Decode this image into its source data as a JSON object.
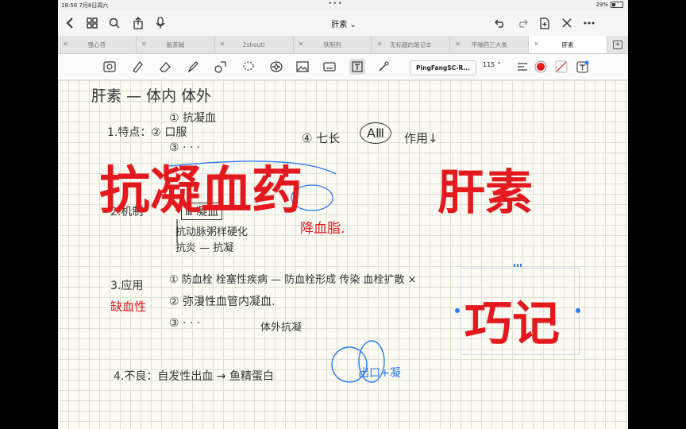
{
  "status": {
    "time": "18:58",
    "date": "7月8日周六",
    "battery": "29%"
  },
  "header": {
    "title": "肝素"
  },
  "tabs": [
    {
      "label": "强心苷",
      "active": false
    },
    {
      "label": "氨茶碱",
      "active": false
    },
    {
      "label": "2shouti",
      "active": false
    },
    {
      "label": "铁制剂",
      "active": false
    },
    {
      "label": "无标题的笔记本",
      "active": false
    },
    {
      "label": "平喘药三大类",
      "active": false
    },
    {
      "label": "肝素",
      "active": true
    }
  ],
  "toolbar": {
    "font_name": "PingFangSC-R...",
    "font_size": "115",
    "pen_color": "#e3191e"
  },
  "note": {
    "big_title_left": "抗凝血药",
    "big_title_right": "肝素",
    "big_tip": "巧记",
    "hw_lines": [
      "肝素 — 体内 体外",
      "① 抗凝血",
      "1.特点：② 口服",
      "③ · · ·",
      "④ 七长",
      "AⅢ",
      "作用↓",
      "2.机制",
      "Ⅲ 凝血",
      "抗动脉粥样硬化",
      "抗炎 — 抗凝",
      "降血脂.",
      "3.应用",
      "① 防血栓 栓塞性疾病 — 防血栓形成 传染 血栓扩散 ×",
      "缺血性",
      "② 弥漫性血管内凝血.",
      "③ · · ·",
      "体外抗凝",
      "4.不良：自发性出血 → 鱼精蛋白",
      "出口+凝"
    ]
  }
}
